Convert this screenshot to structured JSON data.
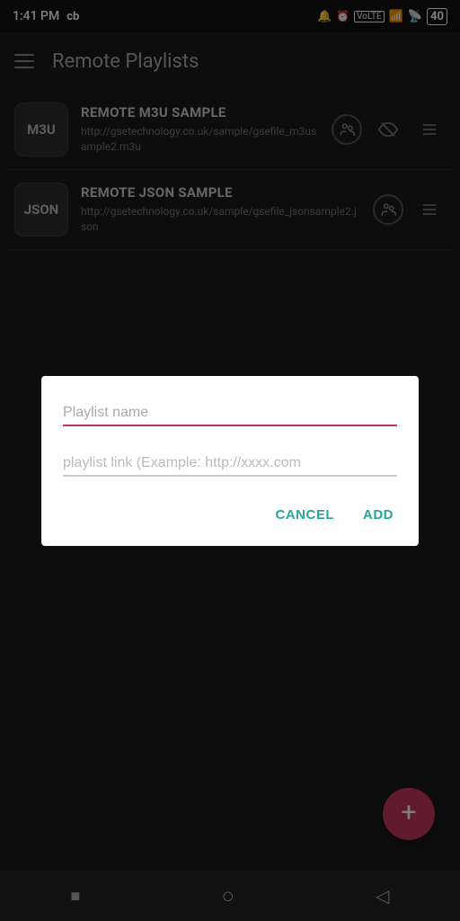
{
  "statusBar": {
    "time": "1:41 PM",
    "carrier": "cb",
    "battery": "40"
  },
  "topBar": {
    "title": "Remote Playlists"
  },
  "playlists": [
    {
      "type": "M3U",
      "name": "REMOTE M3U SAMPLE",
      "url": "http://gsetechnology.co.uk/sample/gsefile_m3usample2.m3u",
      "hasEyeIcon": true
    },
    {
      "type": "JSON",
      "name": "REMOTE JSON SAMPLE",
      "url": "http://gsetechnology.co.uk/sample/gsefile_jsonsample2.json",
      "hasEyeIcon": false
    }
  ],
  "dialog": {
    "namePlaceholder": "Playlist name",
    "linkPlaceholder": "playlist link (Example: http://xxxx.com",
    "cancelLabel": "CANCEL",
    "addLabel": "ADD"
  },
  "fab": {
    "label": "+"
  },
  "bottomNav": {
    "squareIcon": "■",
    "circleIcon": "○",
    "backIcon": "◁"
  }
}
